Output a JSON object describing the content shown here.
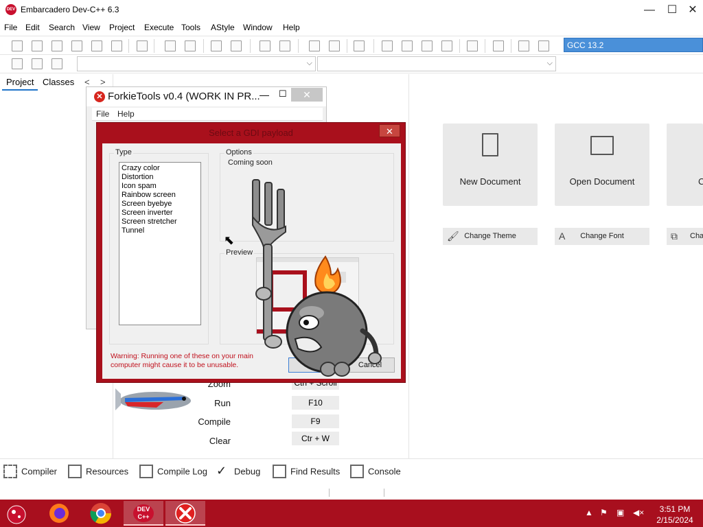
{
  "app": {
    "logo_text": "DEV C++",
    "title": "Embarcadero Dev-C++ 6.3"
  },
  "window_controls": {
    "minimize": "—",
    "maximize": "☐",
    "close": "✕"
  },
  "menubar": [
    "File",
    "Edit",
    "Search",
    "View",
    "Project",
    "Execute",
    "Tools",
    "AStyle",
    "Window",
    "Help"
  ],
  "compiler": {
    "selected": "GCC 13.2"
  },
  "left_panel": {
    "tabs": [
      "Project",
      "Classes"
    ],
    "nav_prev": "<",
    "nav_next": ">"
  },
  "welcome": {
    "tiles": [
      "New Document",
      "Open Document",
      "C"
    ],
    "buttons": [
      "Change Theme",
      "Change Font",
      "Cha"
    ]
  },
  "shortcuts": {
    "rows": [
      {
        "label": "Zoom",
        "key": "Ctrl + Scroll"
      },
      {
        "label": "Run",
        "key": "F10"
      },
      {
        "label": "Compile",
        "key": "F9"
      },
      {
        "label": "Clear",
        "key": "Ctr + W"
      }
    ]
  },
  "bottom_tabs": [
    "Compiler",
    "Resources",
    "Compile Log",
    "Debug",
    "Find Results",
    "Console"
  ],
  "forkie": {
    "title": "ForkieTools v0.4 (WORK IN PR...",
    "menu": [
      "File",
      "Help"
    ]
  },
  "payload_dialog": {
    "title": "Select a GDI payload",
    "type_caption": "Type",
    "options_caption": "Options",
    "options_text": "Coming soon",
    "preview_caption": "Preview",
    "payloads": [
      "Crazy color",
      "Distortion",
      "Icon spam",
      "Rainbow screen",
      "Screen byebye",
      "Screen inverter",
      "Screen stretcher",
      "Tunnel"
    ],
    "warning": "Warning: Running one of these on your main computer might cause it to be unusable.",
    "ok_label": "OK",
    "cancel_label": "Cancel"
  },
  "taskbar": {
    "apps": [
      "start-icon",
      "firefox-icon",
      "chrome-icon",
      "devcpp-icon",
      "forkietools-icon"
    ],
    "devcpp_label": "DEV C++",
    "time": "3:51 PM",
    "date": "2/15/2024"
  },
  "colors": {
    "taskbar": "#a80f1e",
    "dialog_frame": "#a9101c",
    "compiler_select": "#4a90d9",
    "warning_text": "#c0101c"
  }
}
